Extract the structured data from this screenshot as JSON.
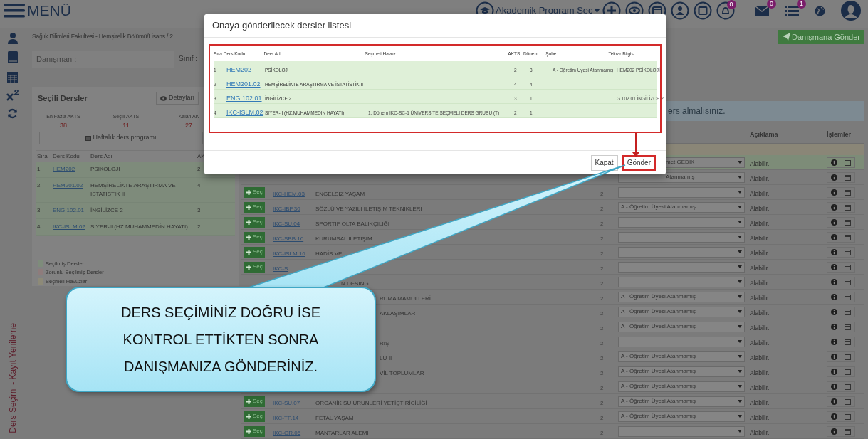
{
  "topbar": {
    "menu_label": "MENÜ",
    "program_selector": "Akademik Program Seç",
    "toolbar_badge": "0",
    "mail_badge": "0",
    "tasks_badge": "1"
  },
  "breadcrumb": "Sağlık Bilimleri Fakultesi - Hemşirelik Bölümü/Lisans / 2",
  "send_button": "Danışmana Gönder",
  "advisor_label": "Danışman :",
  "class_label": "Sınıf :",
  "side_label": "Ders Seçimi - Kayıt Yenileme",
  "selected_panel": {
    "title": "Seçili Dersler",
    "details_button": "Detayları",
    "stats": [
      {
        "label": "En Fazla AKTS",
        "value": "38"
      },
      {
        "label": "Seçili AKTS",
        "value": "11"
      },
      {
        "label": "Kalan AK",
        "value": "27"
      }
    ],
    "schedule_button": "Haftalık ders programı",
    "columns": [
      "Sıra",
      "Ders Kodu",
      "Ders Adı",
      "AK"
    ],
    "rows": [
      {
        "no": "1",
        "code": "HEM202",
        "name": "PSİKOLOJİ",
        "akts": "2"
      },
      {
        "no": "2",
        "code": "HEM201.02",
        "name": "HEMŞİRELİKTE ARAŞTIRMA VE İSTATİSTİK II",
        "akts": "4"
      },
      {
        "no": "3",
        "code": "ENG 102.01",
        "name": "İNGİLİZCE 2",
        "akts": "3"
      },
      {
        "no": "4",
        "code": "IKC-ISLM.02",
        "name": "SİYER-II (HZ.MUHAMMEDİN HAYATI)",
        "akts": "2"
      }
    ],
    "legend": [
      {
        "label": "Seçilmiş Dersler",
        "color": "#7e8c7b"
      },
      {
        "label": "Zorunlu Seçilmiş Dersler",
        "color": "#8e7c7c"
      },
      {
        "label": "Seçmeli Havuzlar",
        "color": "#8d8a78"
      }
    ]
  },
  "course_list": {
    "notice": "ers almalısınız.",
    "columns": [
      "Açıklama",
      "İşlemler"
    ],
    "rows": [
      {
        "kind": "behind-modal",
        "selected": true,
        "sube": "met GEDİK",
        "note": "Alabilir."
      },
      {
        "kind": "behind-modal",
        "selected": false,
        "sube": "Atanmamış",
        "note": "Alabilir."
      },
      {
        "kind": "full",
        "selected": false,
        "button": "Seç",
        "code": "IKC-HEM.03",
        "name": "ENGELSİZ YAŞAM",
        "akts": "2",
        "note": "Alabilir."
      },
      {
        "kind": "full",
        "selected": false,
        "button": "Seç",
        "code": "IKC-İBF.30",
        "name": "SÖZLÜ VE YAZILI İLETİŞİM TEKNİKLERİ",
        "akts": "2",
        "sube": "A - Öğretim Üyesi Atanmamış",
        "note": "Alabilir."
      },
      {
        "kind": "full",
        "selected": false,
        "button": "Seç",
        "code": "IKC-SU.04",
        "name": "SPORTİF OLTA BALIKÇILIĞI",
        "akts": "2",
        "note": "Alabilir."
      },
      {
        "kind": "full",
        "selected": false,
        "button": "Seç",
        "code": "IKC-SBB.16",
        "name": "KURUMSAL İLETİŞİM",
        "akts": "2",
        "note": "Alabilir."
      },
      {
        "kind": "full",
        "selected": false,
        "button": "Seç",
        "code": "IKC-ISLM.16",
        "name": "HADİS VE",
        "akts": "2",
        "note": "Alabilir."
      },
      {
        "kind": "full",
        "selected": false,
        "button": "Seç",
        "code": "IKC-S",
        "akts": "2",
        "note": "Alabilir."
      },
      {
        "kind": "tail",
        "selected": false,
        "name": "N DESING",
        "akts": "2",
        "note": "Alabilir."
      },
      {
        "kind": "covered",
        "selected": false,
        "name": "RUMA MAMULLERİ",
        "akts": "2",
        "sube": "A - Öğretim Üyesi Atanmamış",
        "note": "Alabilir."
      },
      {
        "kind": "covered",
        "selected": false,
        "name": "AKLAŞIMLAR",
        "akts": "2",
        "sube": "A - Öğretim Üyesi Atanmamış",
        "note": "Alabilir."
      },
      {
        "kind": "covered",
        "selected": false,
        "akts": "2",
        "sube": "A - Öğretim Üyesi Atanmamış",
        "note": "Alabilir."
      },
      {
        "kind": "covered",
        "selected": false,
        "name": "RIŞ",
        "akts": "2",
        "note": "Alabilir."
      },
      {
        "kind": "covered",
        "selected": false,
        "name": "LÜ-II",
        "akts": "2",
        "sube": "A - Öğretim Üyesi Atanmamış",
        "note": "Alabilir."
      },
      {
        "kind": "covered",
        "selected": false,
        "name": "VİL TOPLUMLAR",
        "akts": "2",
        "sube": "A - Öğretim Üyesi Atanmamış",
        "note": "Alabilir."
      },
      {
        "kind": "covered",
        "selected": false,
        "akts": "2",
        "sube": "A - Öğretim Üyesi Atanmamış",
        "note": "Alabilir."
      },
      {
        "kind": "full",
        "selected": false,
        "button": "Seç",
        "code": "IKC-SU.07",
        "name": "ORGANİK SU ÜRÜNLERİ YETİŞTİRİCİLİĞİ",
        "akts": "2",
        "sube": "A - Öğretim Üyesi Atanmamış",
        "note": "Alabilir."
      },
      {
        "kind": "full",
        "selected": false,
        "button": "Seç",
        "code": "IKC-TP.14",
        "name": "FETAL YAŞAM",
        "akts": "2",
        "sube": "A - Öğretim Üyesi Atanmamış",
        "note": "Alabilir."
      },
      {
        "kind": "full",
        "selected": false,
        "button": "Seç",
        "code": "IKC-OR.06",
        "name": "MANTARLAR ALEMİ",
        "akts": "2",
        "note": "Alabilir."
      }
    ]
  },
  "modal": {
    "title": "Onaya gönderilecek dersler listesi",
    "columns": [
      "Sıra",
      "Ders Kodu",
      "Ders Adı",
      "Seçmeli Havuz",
      "AKTS",
      "Dönem",
      "Şube",
      "Tekrar Bilgisi"
    ],
    "rows": [
      {
        "no": "1",
        "code": "HEM202",
        "name": "PSİKOLOJİ",
        "pool": "",
        "akts": "2",
        "term": "3",
        "sube": "A - Öğretim Üyesi Atanmamış",
        "repeat": "HEM202 PSİKOLOJİ"
      },
      {
        "no": "2",
        "code": "HEM201.02",
        "name": "HEMŞİRELİKTE ARAŞTIRMA VE İSTATİSTİK II",
        "akts": "4",
        "term": "4"
      },
      {
        "no": "3",
        "code": "ENG 102.01",
        "name": "İNGİLİZCE 2",
        "akts": "3",
        "term": "1",
        "repeat": "G 102.01 İNGİLİZCE 2"
      },
      {
        "no": "4",
        "code": "IKC-ISLM.02",
        "name": "SİYER-II (HZ.MUHAMMEDİN HAYATI)",
        "pool": "1. Dönem IKC-SC-1 ÜNİVERSİTE SEÇMELİ DERS GRUBU (T)",
        "akts": "2",
        "term": "1"
      }
    ],
    "buttons": [
      {
        "label": "Kapat",
        "kind": "default"
      },
      {
        "label": "Gönder",
        "kind": "highlighted"
      }
    ]
  },
  "callout": {
    "lines": [
      "DERS SEÇİMİNİZ DOĞRU İSE",
      "KONTROL ETTİKTEN SONRA",
      "DANIŞMANIZA GÖNDERİNİZ."
    ]
  }
}
